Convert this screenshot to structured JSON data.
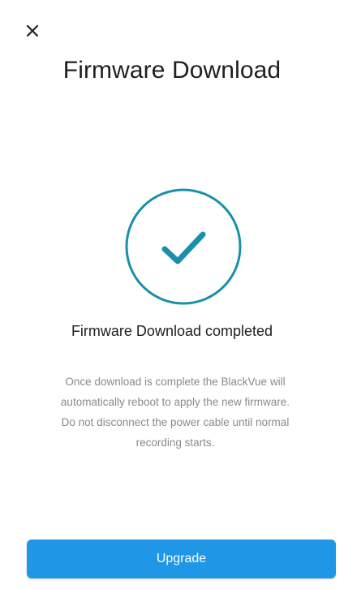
{
  "header": {
    "close_icon": "close-icon",
    "title": "Firmware Download"
  },
  "status": {
    "icon": "check-circle-icon",
    "accent_color": "#1a8fab",
    "text": "Firmware Download completed"
  },
  "description": {
    "line1": "Once download is complete the BlackVue will automatically reboot to apply the new firmware.",
    "line2": "Do not disconnect the power cable until normal recording starts."
  },
  "actions": {
    "upgrade_label": "Upgrade",
    "button_color": "#1f97e6"
  }
}
